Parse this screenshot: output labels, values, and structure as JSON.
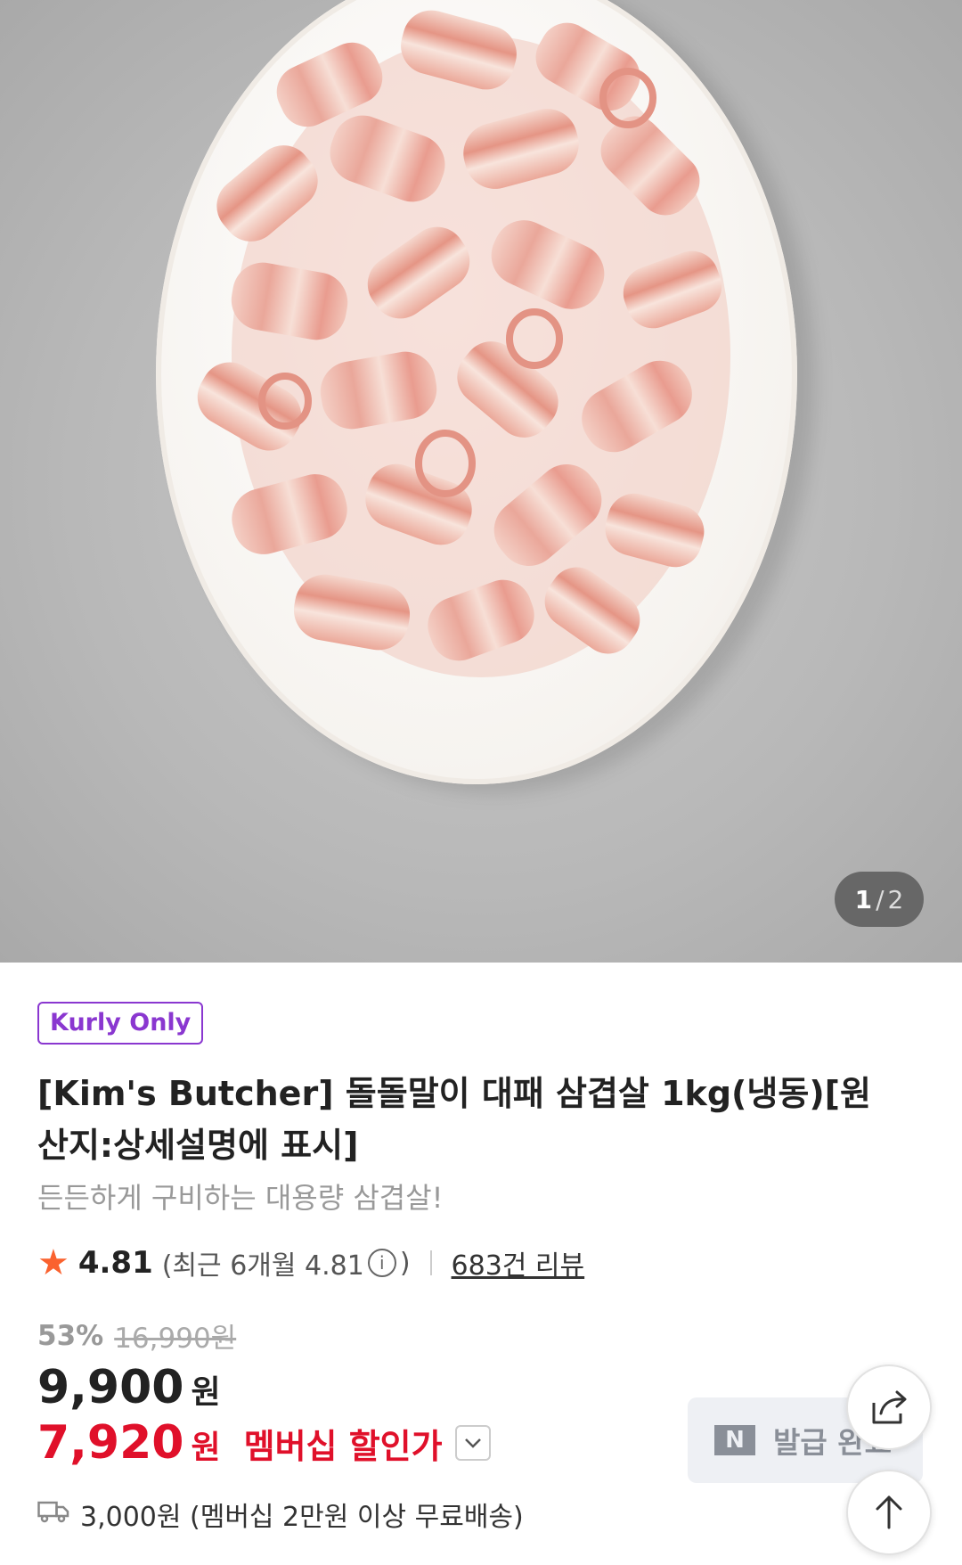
{
  "gallery": {
    "current": "1",
    "separator": "/",
    "total": "2"
  },
  "product": {
    "badge": "Kurly Only",
    "title": "[Kim's Butcher] 돌돌말이 대패 삼겹살 1kg(냉동)[원산지:상세설명에 표시]",
    "subtitle": "든든하게 구비하는 대용량 삼겹살!"
  },
  "rating": {
    "icon": "star-icon",
    "value": "4.81",
    "recent_prefix": "(최근 6개월 4.81",
    "recent_suffix": ")",
    "review_link": "683건 리뷰"
  },
  "pricing": {
    "discount_rate": "53%",
    "original_price": "16,990원",
    "price": "9,900",
    "price_unit": "원",
    "member_price": "7,920",
    "member_unit": "원",
    "member_label": "멤버십 할인가"
  },
  "shipping": {
    "text": "3,000원 (멤버십 2만원 이상 무료배송)"
  },
  "coupon": {
    "label": "발급 완료"
  },
  "colors": {
    "accent_purple": "#8a37d0",
    "price_red": "#e0102a",
    "star_orange": "#fa622f"
  }
}
